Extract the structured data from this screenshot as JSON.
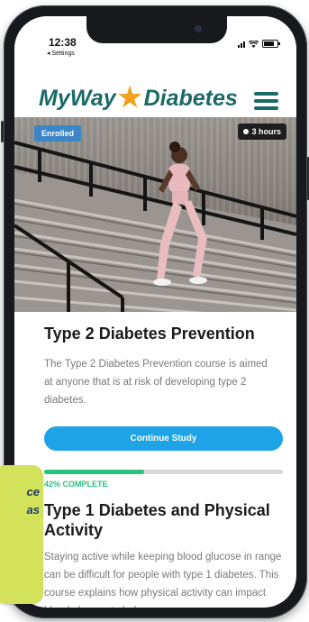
{
  "status_bar": {
    "time": "12:38",
    "back_link": "◂ Settings"
  },
  "header": {
    "brand_left": "MyWay",
    "brand_right": "Diabetes",
    "brand_color": "#1c6a68",
    "star_color": "#f0a21f",
    "menu_icon": "hamburger-menu-icon"
  },
  "hero": {
    "enrolled_badge": "Enrolled",
    "duration_badge": "3 hours",
    "duration_icon": "clock-icon"
  },
  "courses": [
    {
      "title": "Type 2 Diabetes Prevention",
      "description": "The Type 2 Diabetes Prevention course is aimed at anyone that is at risk of developing type 2 diabetes.",
      "button_label": "Continue Study",
      "progress_percent": 42,
      "progress_label": "42% COMPLETE"
    },
    {
      "title": "Type 1 Diabetes and Physical Activity",
      "description": "Staying active while keeping blood glucose in range can be difficult for people with type 1 diabetes. This course explains how physical activity can impact blood glucose to help you"
    }
  ],
  "callout": {
    "line1": "ce",
    "line2": "as"
  },
  "colors": {
    "cta": "#1ea3e6",
    "progress": "#29c37b",
    "enrolled_badge": "#3a86c8",
    "callout": "#d2e25b"
  }
}
